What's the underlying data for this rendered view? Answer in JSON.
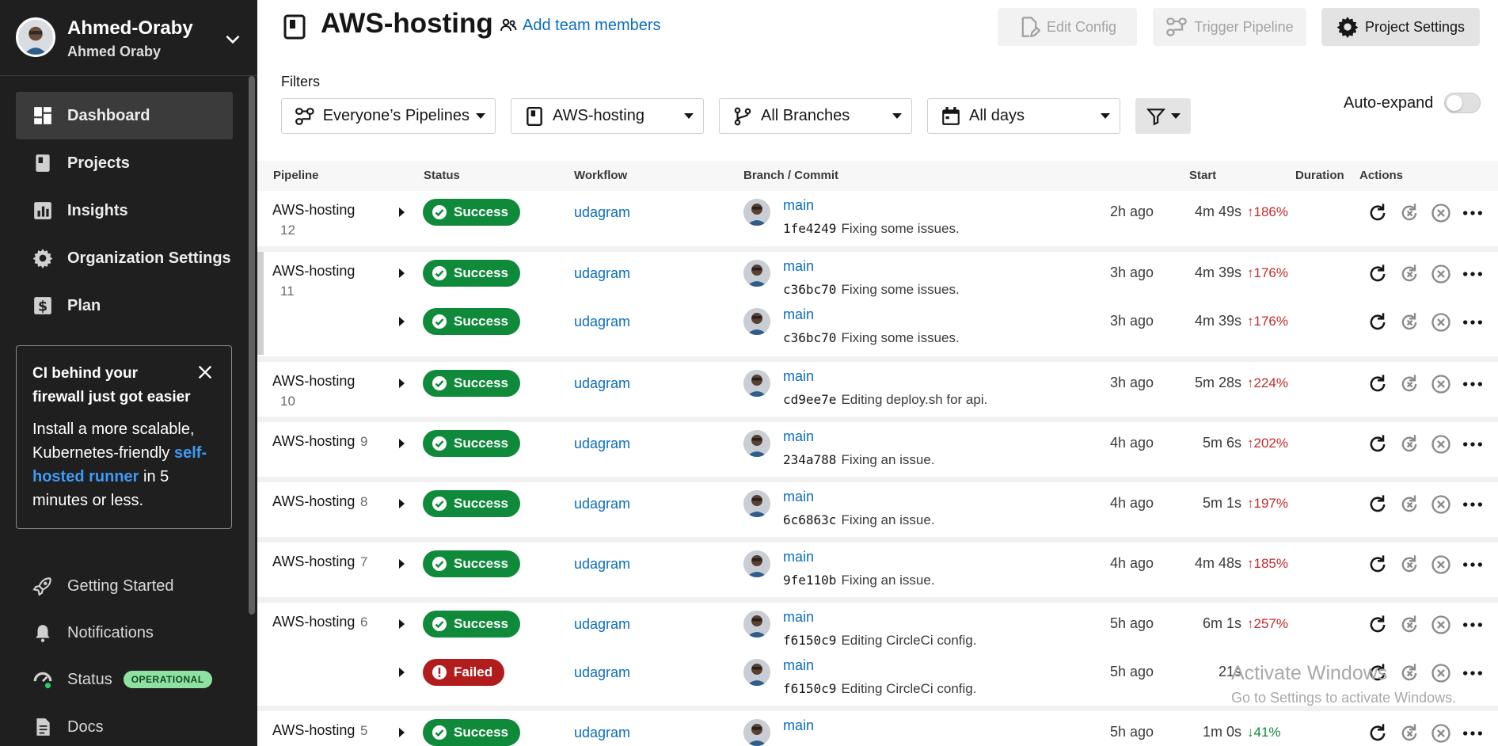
{
  "colors": {
    "sidebar_bg": "#1f1f1f",
    "link_blue": "#0b6dbf",
    "success_green": "#0f8a3a",
    "failed_red": "#b11c1c",
    "increase_red": "#c52b2b",
    "decrease_green": "#0f8a3a",
    "operational_green": "#8ee0a3"
  },
  "account": {
    "org_name": "Ahmed-Oraby",
    "user_name": "Ahmed Oraby"
  },
  "sidebar": {
    "nav": [
      {
        "label": "Dashboard",
        "icon": "dashboard-icon",
        "active": true
      },
      {
        "label": "Projects",
        "icon": "projects-icon"
      },
      {
        "label": "Insights",
        "icon": "insights-icon"
      },
      {
        "label": "Organization Settings",
        "icon": "gear-icon"
      },
      {
        "label": "Plan",
        "icon": "dollar-icon"
      }
    ],
    "promo": {
      "title": "CI behind your firewall just got easier",
      "body_before": "Install a more scalable, Kubernetes-friendly ",
      "link_text": "self-hosted runner",
      "body_after": " in 5 minutes or less."
    },
    "lower": [
      {
        "label": "Getting Started",
        "icon": "rocket-icon"
      },
      {
        "label": "Notifications",
        "icon": "bell-icon"
      },
      {
        "label": "Status",
        "icon": "status-icon",
        "badge": "OPERATIONAL"
      },
      {
        "label": "Docs",
        "icon": "docs-icon"
      }
    ]
  },
  "header": {
    "title": "AWS-hosting",
    "add_team": "Add team members",
    "buttons": {
      "edit_config": "Edit Config",
      "trigger_pipeline": "Trigger Pipeline",
      "project_settings": "Project Settings"
    }
  },
  "filters": {
    "label": "Filters",
    "pipelines": "Everyone’s Pipelines",
    "project": "AWS-hosting",
    "branches": "All Branches",
    "days": "All days",
    "auto_expand": "Auto-expand"
  },
  "table": {
    "columns": [
      "Pipeline",
      "Status",
      "Workflow",
      "Branch / Commit",
      "Start",
      "Duration",
      "Actions"
    ],
    "groups": [
      {
        "name": "AWS-hosting",
        "number": "12",
        "wrap": true,
        "rows": [
          {
            "status": "Success",
            "workflow": "udagram",
            "branch": "main",
            "hash": "1fe4249",
            "message": "Fixing some issues.",
            "start": "2h ago",
            "duration": "4m 49s",
            "change": "186%",
            "dir": "up"
          }
        ]
      },
      {
        "name": "AWS-hosting",
        "number": "11",
        "wrap": true,
        "rows": [
          {
            "status": "Success",
            "workflow": "udagram",
            "branch": "main",
            "hash": "c36bc70",
            "message": "Fixing some issues.",
            "start": "3h ago",
            "duration": "4m 39s",
            "change": "176%",
            "dir": "up"
          },
          {
            "status": "Success",
            "workflow": "udagram",
            "branch": "main",
            "hash": "c36bc70",
            "message": "Fixing some issues.",
            "start": "3h ago",
            "duration": "4m 39s",
            "change": "176%",
            "dir": "up"
          }
        ]
      },
      {
        "name": "AWS-hosting",
        "number": "10",
        "wrap": true,
        "rows": [
          {
            "status": "Success",
            "workflow": "udagram",
            "branch": "main",
            "hash": "cd9ee7e",
            "message": "Editing deploy.sh for api.",
            "start": "3h ago",
            "duration": "5m 28s",
            "change": "224%",
            "dir": "up"
          }
        ]
      },
      {
        "name": "AWS-hosting",
        "number": "9",
        "wrap": false,
        "rows": [
          {
            "status": "Success",
            "workflow": "udagram",
            "branch": "main",
            "hash": "234a788",
            "message": "Fixing an issue.",
            "start": "4h ago",
            "duration": "5m 6s",
            "change": "202%",
            "dir": "up"
          }
        ]
      },
      {
        "name": "AWS-hosting",
        "number": "8",
        "wrap": false,
        "rows": [
          {
            "status": "Success",
            "workflow": "udagram",
            "branch": "main",
            "hash": "6c6863c",
            "message": "Fixing an issue.",
            "start": "4h ago",
            "duration": "5m 1s",
            "change": "197%",
            "dir": "up"
          }
        ]
      },
      {
        "name": "AWS-hosting",
        "number": "7",
        "wrap": false,
        "rows": [
          {
            "status": "Success",
            "workflow": "udagram",
            "branch": "main",
            "hash": "9fe110b",
            "message": "Fixing an issue.",
            "start": "4h ago",
            "duration": "4m 48s",
            "change": "185%",
            "dir": "up"
          }
        ]
      },
      {
        "name": "AWS-hosting",
        "number": "6",
        "wrap": false,
        "rows": [
          {
            "status": "Success",
            "workflow": "udagram",
            "branch": "main",
            "hash": "f6150c9",
            "message": "Editing CircleCi config.",
            "start": "5h ago",
            "duration": "6m 1s",
            "change": "257%",
            "dir": "up"
          },
          {
            "status": "Failed",
            "workflow": "udagram",
            "branch": "main",
            "hash": "f6150c9",
            "message": "Editing CircleCi config.",
            "start": "5h ago",
            "duration": "21s",
            "change": "",
            "dir": ""
          }
        ]
      },
      {
        "name": "AWS-hosting",
        "number": "5",
        "wrap": false,
        "rows": [
          {
            "status": "Success",
            "workflow": "udagram",
            "branch": "main",
            "hash": "",
            "message": "",
            "start": "5h ago",
            "duration": "1m 0s",
            "change": "41%",
            "dir": "down"
          }
        ]
      }
    ]
  },
  "watermark": {
    "line1": "Activate Windows",
    "line2": "Go to Settings to activate Windows."
  }
}
